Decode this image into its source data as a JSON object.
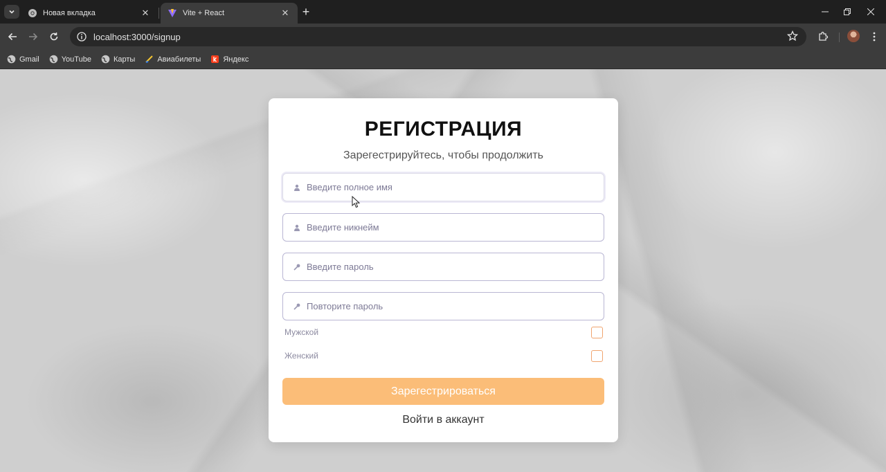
{
  "browser": {
    "tabs": [
      {
        "title": "Новая вкладка",
        "active": false
      },
      {
        "title": "Vite + React",
        "active": true
      }
    ],
    "url": "localhost:3000/signup",
    "bookmarks": [
      {
        "label": "Gmail",
        "icon": "globe-icon"
      },
      {
        "label": "YouTube",
        "icon": "globe-icon"
      },
      {
        "label": "Карты",
        "icon": "globe-icon"
      },
      {
        "label": "Авиабилеты",
        "icon": "plane-icon"
      },
      {
        "label": "Яндекс",
        "icon": "yandex-icon"
      }
    ]
  },
  "signup": {
    "title": "РЕГИСТРАЦИЯ",
    "subtitle": "Зарегестрируйтесь, чтобы продолжить",
    "fields": [
      {
        "placeholder": "Введите полное имя",
        "icon": "user-icon",
        "value": ""
      },
      {
        "placeholder": "Введите никнейм",
        "icon": "user-icon",
        "value": ""
      },
      {
        "placeholder": "Введите пароль",
        "icon": "key-icon",
        "value": ""
      },
      {
        "placeholder": "Повторите пароль",
        "icon": "key-icon",
        "value": ""
      }
    ],
    "gender_options": [
      {
        "label": "Мужской",
        "checked": false
      },
      {
        "label": "Женский",
        "checked": false
      }
    ],
    "submit_label": "Зарегестрироваться",
    "login_link": "Войти в аккаунт"
  },
  "colors": {
    "accent": "#fbbd78",
    "checkbox_border": "#f0a46e",
    "input_border": "#b9b6d3"
  }
}
